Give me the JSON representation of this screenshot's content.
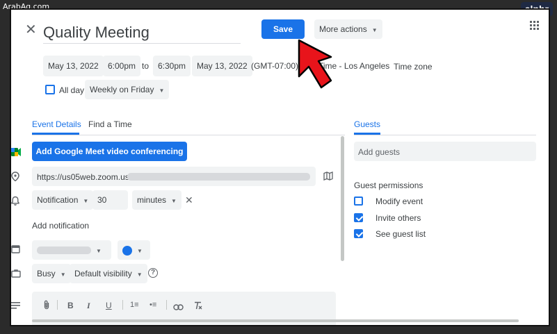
{
  "watermark": "ArabAq.com",
  "brand": "alphr",
  "header": {
    "title": "Quality Meeting",
    "save_label": "Save",
    "more_actions_label": "More actions"
  },
  "datetime": {
    "start_date": "May 13, 2022",
    "start_time": "6:00pm",
    "to_label": "to",
    "end_time": "6:30pm",
    "end_date": "May 13, 2022",
    "timezone_offset": "(GMT-07:00)",
    "timezone_name": "Time - Los Angeles",
    "timezone_link": "Time zone"
  },
  "allday": {
    "label": "All day",
    "checked": false,
    "recurrence": "Weekly on Friday"
  },
  "tabs": {
    "event_details": "Event Details",
    "find_time": "Find a Time",
    "guests": "Guests"
  },
  "details": {
    "meet_button": "Add Google Meet video conferencing",
    "location_value": "https://us05web.zoom.us/",
    "notification_type": "Notification",
    "notification_value": "30",
    "notification_unit": "minutes",
    "add_notification": "Add notification",
    "availability": "Busy",
    "visibility": "Default visibility",
    "calendar_color": "#1a73e8"
  },
  "guests": {
    "add_placeholder": "Add guests",
    "permissions_label": "Guest permissions",
    "permissions": [
      {
        "label": "Modify event",
        "checked": false
      },
      {
        "label": "Invite others",
        "checked": true
      },
      {
        "label": "See guest list",
        "checked": true
      }
    ]
  },
  "colors": {
    "accent": "#1a73e8",
    "arrow": "#e8141b"
  }
}
